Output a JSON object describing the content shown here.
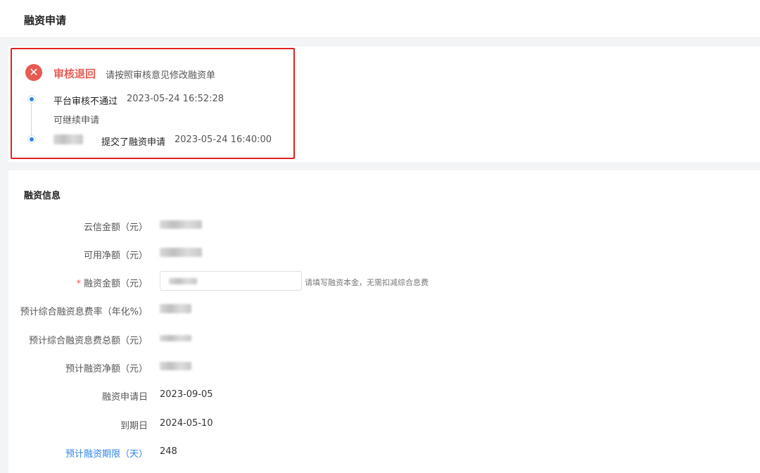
{
  "header": {
    "title": "融资申请"
  },
  "status": {
    "title": "审核退回",
    "description": "请按照审核意见修改融资单",
    "icon": "close-icon",
    "timeline": [
      {
        "text": "平台审核不通过",
        "time": "2023-05-24 16:52:28",
        "note": "可继续申请"
      },
      {
        "text": "提交了融资申请",
        "time": "2023-05-24 16:40:00"
      }
    ]
  },
  "info": {
    "section_title": "融资信息",
    "fields": {
      "cloud_amount_label": "云信金额（元）",
      "available_net_label": "可用净额（元）",
      "financing_amount_label": "融资金额（元）",
      "financing_amount_required": "*",
      "financing_amount_hint": "请填写融资本金，无需扣减综合息费",
      "rate_label": "预计综合融资息费率（年化%）",
      "fee_total_label": "预计综合融资息费总额（元）",
      "net_amount_label": "预计融资净额（元）",
      "apply_date_label": "融资申请日",
      "apply_date_value": "2023-09-05",
      "due_date_label": "到期日",
      "due_date_value": "2024-05-10",
      "term_label": "预计融资期限（天）",
      "term_value": "248"
    }
  },
  "colors": {
    "accent_blue": "#2f86e6",
    "reject_red": "#e85a52",
    "highlight_border": "#e02020"
  }
}
